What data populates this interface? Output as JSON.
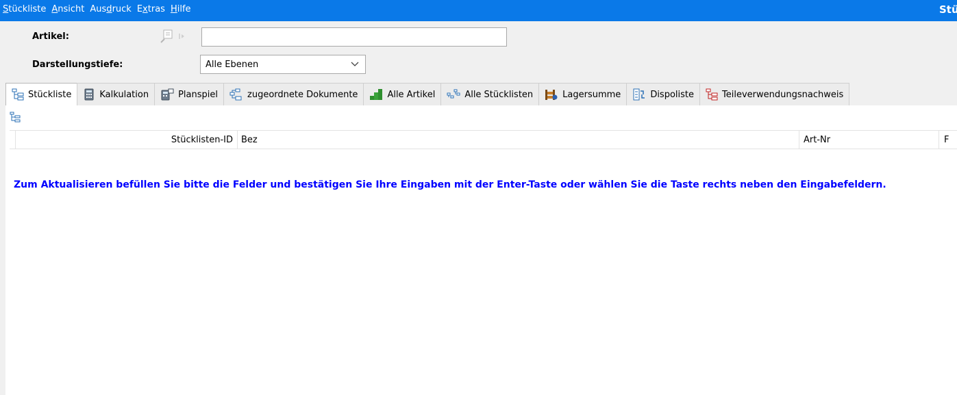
{
  "menubar": {
    "items": [
      {
        "mnemonic": "S",
        "rest": "tückliste"
      },
      {
        "mnemonic": "A",
        "rest": "nsicht"
      },
      {
        "pre": "Aus",
        "mnemonic": "d",
        "rest": "ruck"
      },
      {
        "pre": "E",
        "mnemonic": "x",
        "rest": "tras"
      },
      {
        "mnemonic": "H",
        "rest": "ilfe"
      }
    ],
    "window_title": "Stückliste"
  },
  "form": {
    "article_label": "Artikel:",
    "article_value": "",
    "depth_label": "Darstellungstiefe:",
    "depth_value": "Alle Ebenen"
  },
  "tabs": [
    {
      "label": "Stückliste",
      "icon": "tree-icon",
      "active": true
    },
    {
      "label": "Kalkulation",
      "icon": "calculator-icon"
    },
    {
      "label": "Planspiel",
      "icon": "calculator-play-icon"
    },
    {
      "label": "zugeordnete Dokumente",
      "icon": "documents-tree-icon"
    },
    {
      "label": "Alle Artikel",
      "icon": "green-stairs-icon"
    },
    {
      "label": "Alle Stücklisten",
      "icon": "multi-tree-icon"
    },
    {
      "label": "Lagersumme",
      "icon": "warehouse-icon"
    },
    {
      "label": "Dispoliste",
      "icon": "dispo-list-icon"
    },
    {
      "label": "Teileverwendungsnachweis",
      "icon": "parts-usage-icon"
    }
  ],
  "table": {
    "columns": [
      "Stücklisten-ID",
      "Bez",
      "Art-Nr",
      "F"
    ]
  },
  "info_message": "Zum Aktualisieren befüllen Sie bitte die Felder und bestätigen Sie Ihre Eingaben mit der Enter-Taste oder wählen Sie die Taste rechts neben den Eingabefeldern.",
  "colors": {
    "menubar": "#0a79e8",
    "info_text": "#0000ff"
  }
}
